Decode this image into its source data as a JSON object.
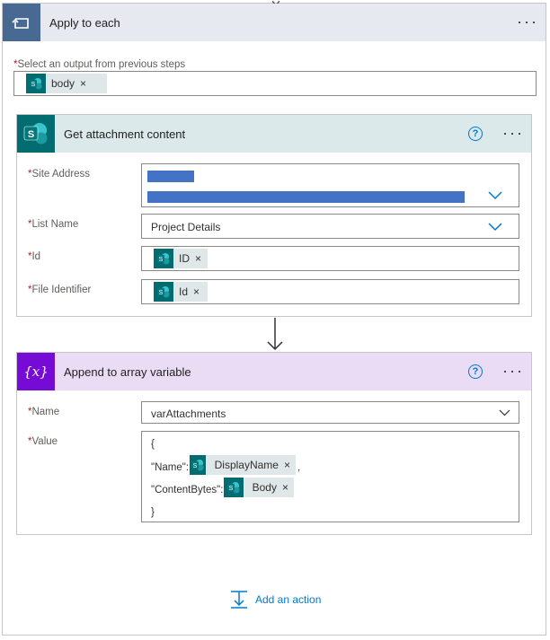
{
  "scope": {
    "title": "Apply to each",
    "more_label": "···",
    "select_output_label": "Select an output from previous steps",
    "required_mark": "*",
    "output_token": {
      "label": "body",
      "remove": "×",
      "icon": "sharepoint-icon"
    }
  },
  "get_attachment": {
    "title": "Get attachment content",
    "help_label": "?",
    "more_label": "···",
    "accent": "#036c70",
    "header_bg": "#dbe9eb",
    "fields": {
      "site_address": {
        "label": "Site Address"
      },
      "list_name": {
        "label": "List Name",
        "value": "Project Details"
      },
      "id": {
        "label": "Id",
        "token": "ID",
        "remove": "×"
      },
      "file_identifier": {
        "label": "File Identifier",
        "token": "Id",
        "remove": "×"
      }
    }
  },
  "append_variable": {
    "title": "Append to array variable",
    "help_label": "?",
    "more_label": "···",
    "accent": "#770bd6",
    "header_bg": "#eadcf4",
    "fields": {
      "name": {
        "label": "Name",
        "value": "varAttachments"
      },
      "value": {
        "label": "Value",
        "line_open": "{",
        "name_key": "\"Name\":",
        "name_token": "DisplayName",
        "comma": ",",
        "content_key": "\"ContentBytes\":",
        "content_token": "Body",
        "line_close": "}",
        "remove": "×"
      }
    }
  },
  "add_action": {
    "label": "Add an action"
  },
  "colors": {
    "scope_header": "#e7e9f1",
    "scope_icon_bg": "#486991",
    "redacted_bar": "#4472c4",
    "link": "#0078d4"
  }
}
